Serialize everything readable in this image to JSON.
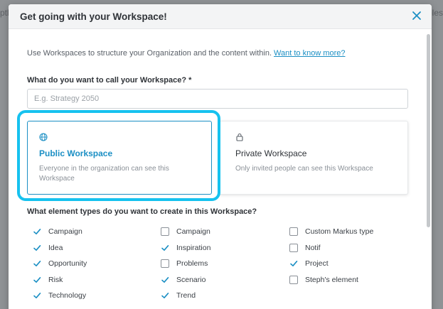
{
  "background": {
    "left_fragment": "ptl",
    "right_fragment": "ples"
  },
  "modal": {
    "title": "Get going with your Workspace!",
    "intro_text": "Use Workspaces to structure your Organization and the content within.",
    "intro_link": "Want to know more?",
    "name_label": "What do you want to call your Workspace? *",
    "name_placeholder": "E.g. Strategy 2050",
    "name_value": "",
    "public": {
      "icon": "globe-icon",
      "title": "Public Workspace",
      "description": "Everyone in the organization can see this Workspace",
      "selected": true
    },
    "private": {
      "icon": "lock-icon",
      "title": "Private Workspace",
      "description": "Only invited people can see this Workspace",
      "selected": false
    },
    "types_label": "What element types do you want to create in this Workspace?",
    "types_columns": [
      [
        {
          "label": "Campaign",
          "checked": true
        },
        {
          "label": "Idea",
          "checked": true
        },
        {
          "label": "Opportunity",
          "checked": true
        },
        {
          "label": "Risk",
          "checked": true
        },
        {
          "label": "Technology",
          "checked": true
        }
      ],
      [
        {
          "label": "Campaign",
          "checked": false
        },
        {
          "label": "Inspiration",
          "checked": true
        },
        {
          "label": "Problems",
          "checked": false
        },
        {
          "label": "Scenario",
          "checked": true
        },
        {
          "label": "Trend",
          "checked": true
        }
      ],
      [
        {
          "label": "Custom Markus type",
          "checked": false
        },
        {
          "label": "Notif",
          "checked": false
        },
        {
          "label": "Project",
          "checked": true
        },
        {
          "label": "Steph's element",
          "checked": false
        }
      ]
    ]
  },
  "colors": {
    "accent": "#1b8fc4",
    "highlight": "#16c2ef",
    "text": "#2f3338"
  }
}
